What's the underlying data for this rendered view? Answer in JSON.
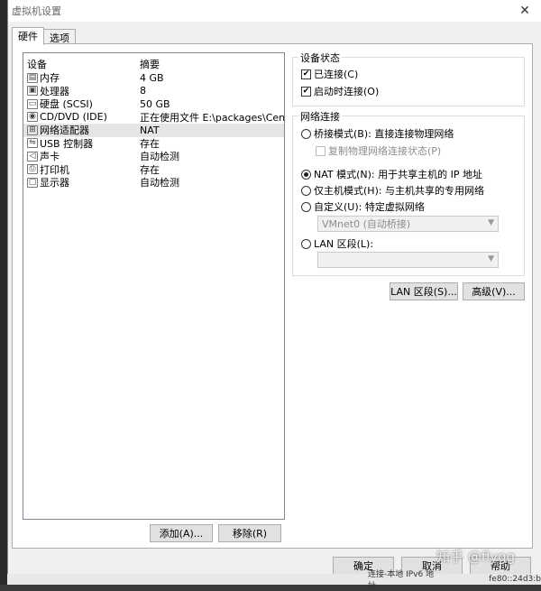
{
  "window": {
    "title": "虚拟机设置",
    "close_glyph": "✕"
  },
  "tabs": [
    {
      "label": "硬件"
    },
    {
      "label": "选项"
    }
  ],
  "device_list": {
    "headers": {
      "device": "设备",
      "summary": "摘要"
    },
    "rows": [
      {
        "name": "内存",
        "summary": "4 GB",
        "icon": "memory-icon"
      },
      {
        "name": "处理器",
        "summary": "8",
        "icon": "processor-icon"
      },
      {
        "name": "硬盘 (SCSI)",
        "summary": "50 GB",
        "icon": "hard-disk-icon"
      },
      {
        "name": "CD/DVD (IDE)",
        "summary": "正在使用文件 E:\\packages\\Cen...",
        "icon": "cd-dvd-icon"
      },
      {
        "name": "网络适配器",
        "summary": "NAT",
        "icon": "network-adapter-icon"
      },
      {
        "name": "USB 控制器",
        "summary": "存在",
        "icon": "usb-icon"
      },
      {
        "name": "声卡",
        "summary": "自动检测",
        "icon": "sound-card-icon"
      },
      {
        "name": "打印机",
        "summary": "存在",
        "icon": "printer-icon"
      },
      {
        "name": "显示器",
        "summary": "自动检测",
        "icon": "display-icon"
      }
    ],
    "selected_index": 4
  },
  "device_buttons": {
    "add": "添加(A)...",
    "remove": "移除(R)"
  },
  "device_status": {
    "title": "设备状态",
    "connected": {
      "label": "已连接(C)",
      "checked": true
    },
    "connect_on_power": {
      "label": "启动时连接(O)",
      "checked": true
    }
  },
  "network": {
    "title": "网络连接",
    "bridged": {
      "label": "桥接模式(B): 直接连接物理网络",
      "selected": false
    },
    "replicate": {
      "label": "复制物理网络连接状态(P)",
      "checked": false
    },
    "nat": {
      "label": "NAT 模式(N): 用于共享主机的 IP 地址",
      "selected": true
    },
    "host_only": {
      "label": "仅主机模式(H): 与主机共享的专用网络",
      "selected": false
    },
    "custom": {
      "label": "自定义(U): 特定虚拟网络",
      "selected": false
    },
    "custom_select": "VMnet0 (自动桥接)",
    "lan_segment": {
      "label": "LAN 区段(L):",
      "selected": false
    },
    "lan_select": ""
  },
  "adapter_buttons": {
    "lan_segments": "LAN 区段(S)...",
    "advanced": "高级(V)..."
  },
  "dialog_buttons": {
    "ok": "确定",
    "cancel": "取消",
    "help": "帮助"
  },
  "watermark": "知乎 @flygg",
  "background_fragments": {
    "left": "连接-本地 IPv6 地址",
    "right": "fe80::24d3:b"
  }
}
